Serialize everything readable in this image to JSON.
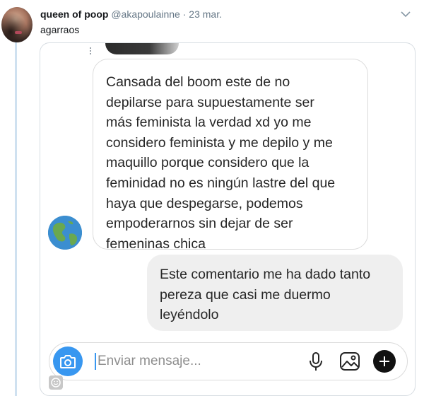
{
  "tweet": {
    "name": "queen of poop",
    "handle": "@akapoulainne",
    "separator": "·",
    "date": "23 mar.",
    "text": "agarraos"
  },
  "messages": {
    "incoming": "Cansada del boom este de no\ndepilarse para supuestamente ser\nmás feminista la verdad xd yo me\nconsidero feminista y me depilo y me\nmaquillo porque considero que la\nfeminidad no es ningún lastre del que\nhaya que despegarse, podemos\nempoderarnos sin dejar de ser\nfemeninas chica",
    "outgoing": "Este comentario me ha dado tanto\npereza que casi me duermo\nleyéndolo"
  },
  "composer": {
    "placeholder": "Enviar mensaje..."
  },
  "colors": {
    "accent": "#3897f0",
    "bubble_out": "#efefef",
    "thread_line": "#cfe1f0"
  },
  "icons": [
    "chevron-down-icon",
    "camera-icon",
    "microphone-icon",
    "gallery-icon",
    "plus-icon",
    "globe-icon",
    "emoji-icon"
  ]
}
